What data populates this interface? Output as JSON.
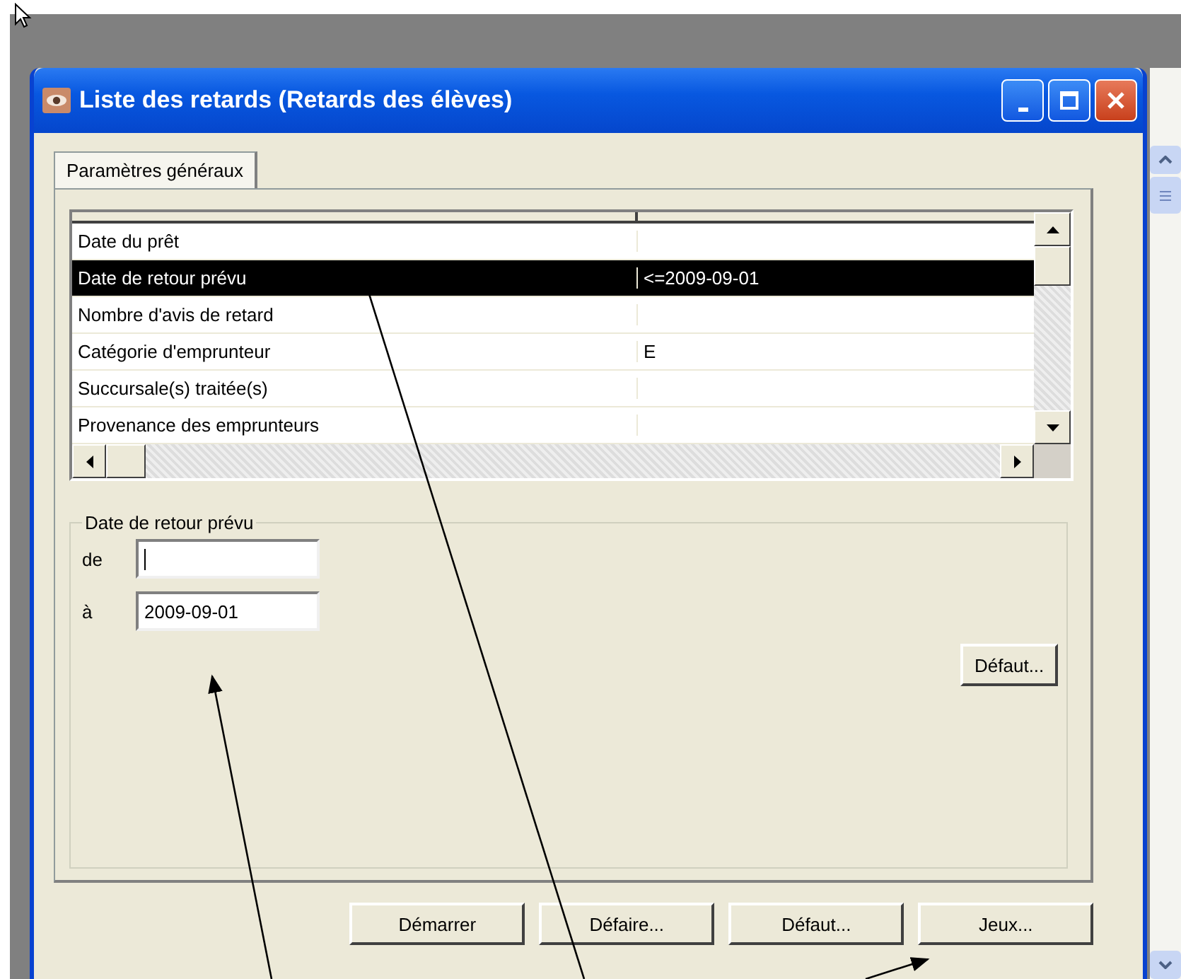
{
  "window": {
    "title": "Liste des retards (Retards des élèves)"
  },
  "tabs": [
    {
      "label": "Paramètres généraux",
      "selected": true
    }
  ],
  "table": {
    "rows": [
      {
        "label": "Date du prêt",
        "selected": false
      },
      {
        "label": "Date de retour prévu",
        "value": "<=2009-09-01",
        "selected": true
      },
      {
        "label": "Nombre d'avis de retard",
        "selected": false
      },
      {
        "label": "Catégorie d'emprunteur",
        "value": "E",
        "selected": false
      },
      {
        "label": "Succursale(s) traitée(s)",
        "selected": false
      },
      {
        "label": "Provenance des emprunteurs",
        "selected": false
      }
    ]
  },
  "group": {
    "title": "Date de retour prévu",
    "fields": [
      {
        "label": "de",
        "focused": true
      },
      {
        "label": "à",
        "value": "2009-09-01",
        "focused": false
      }
    ],
    "button": "Défaut..."
  },
  "buttons": [
    {
      "label": "Démarrer"
    },
    {
      "label": "Défaire..."
    },
    {
      "label": "Défaut..."
    },
    {
      "label": "Jeux..."
    }
  ]
}
